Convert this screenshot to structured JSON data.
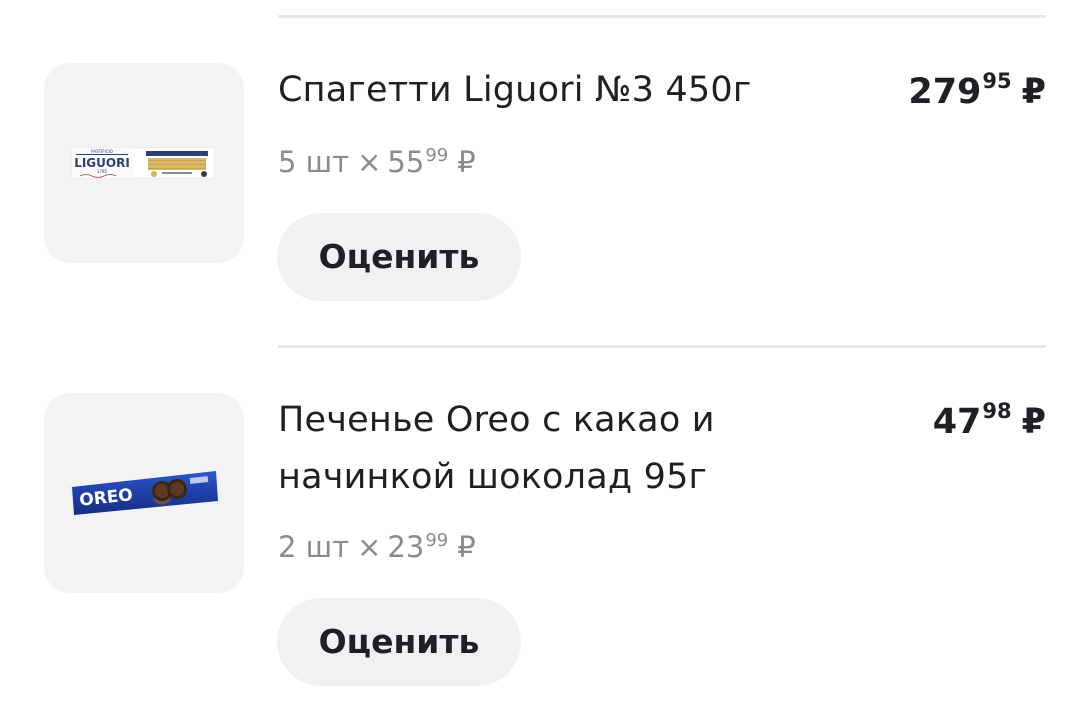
{
  "currency": "₽",
  "times_sign": "×",
  "items": [
    {
      "title": "Спагетти Liguori №3 450г",
      "quantity": "5 шт",
      "unit_price_main": "55",
      "unit_price_cents": "99",
      "total_main": "279",
      "total_cents": "95",
      "rate_label": "Оценить",
      "image": {
        "brand": "LIGUORI",
        "tagline": "PASTIFICIO",
        "year": "1795"
      }
    },
    {
      "title": "Печенье Oreo с какао и начинкой шоколад 95г",
      "quantity": "2 шт",
      "unit_price_main": "23",
      "unit_price_cents": "99",
      "total_main": "47",
      "total_cents": "98",
      "rate_label": "Оценить",
      "image": {
        "brand": "OREO"
      }
    }
  ],
  "colors": {
    "text_primary": "#1f2024",
    "text_secondary": "#8a8b91",
    "button_bg": "#f1f1f3",
    "thumb_bg": "#f3f3f5",
    "divider": "#e6e6e9",
    "oreo_blue": "#1f3fa6"
  }
}
